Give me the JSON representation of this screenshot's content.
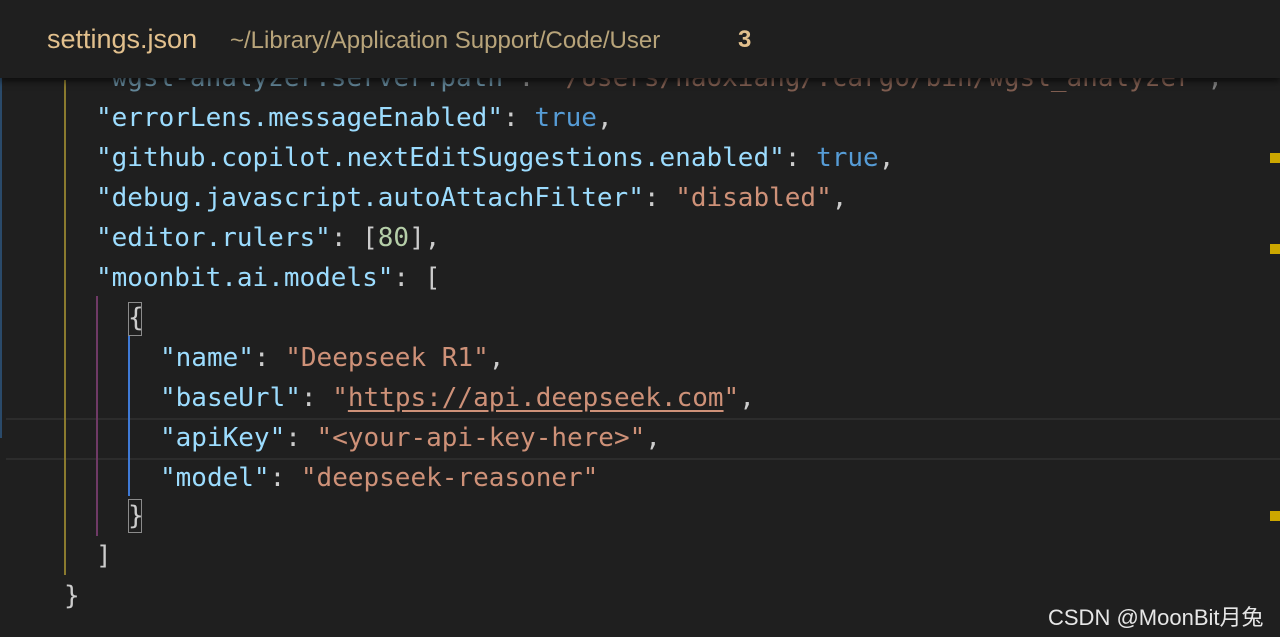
{
  "title_bar": {
    "file_name": "settings.json",
    "path": "~/Library/Application Support/Code/User",
    "problem_count": "3"
  },
  "editor": {
    "lines": [
      {
        "tokens": [
          {
            "text": "\"wgsl-analyzer.server.path\"",
            "cls": "k"
          },
          {
            "text": ": ",
            "cls": "p"
          },
          {
            "text": "\"/Users/haoxiang/.cargo/bin/wgsl_analyzer\"",
            "cls": "s"
          },
          {
            "text": ",",
            "cls": "p"
          }
        ]
      },
      {
        "tokens": [
          {
            "text": "\"errorLens.messageEnabled\"",
            "cls": "k"
          },
          {
            "text": ": ",
            "cls": "p"
          },
          {
            "text": "true",
            "cls": "b"
          },
          {
            "text": ",",
            "cls": "p"
          }
        ]
      },
      {
        "tokens": [
          {
            "text": "\"github.copilot.nextEditSuggestions.enabled\"",
            "cls": "k"
          },
          {
            "text": ": ",
            "cls": "p"
          },
          {
            "text": "true",
            "cls": "b"
          },
          {
            "text": ",",
            "cls": "p"
          }
        ]
      },
      {
        "tokens": [
          {
            "text": "\"debug.javascript.autoAttachFilter\"",
            "cls": "k"
          },
          {
            "text": ": ",
            "cls": "p"
          },
          {
            "text": "\"disabled\"",
            "cls": "s"
          },
          {
            "text": ",",
            "cls": "p"
          }
        ]
      },
      {
        "tokens": [
          {
            "text": "\"editor.rulers\"",
            "cls": "k"
          },
          {
            "text": ": [",
            "cls": "p"
          },
          {
            "text": "80",
            "cls": "n"
          },
          {
            "text": "],",
            "cls": "p"
          }
        ]
      },
      {
        "tokens": [
          {
            "text": "\"moonbit.ai.models\"",
            "cls": "k"
          },
          {
            "text": ": [",
            "cls": "p"
          }
        ]
      },
      {
        "tokens": [
          {
            "text": "{",
            "cls": "p"
          }
        ]
      },
      {
        "tokens": [
          {
            "text": "\"name\"",
            "cls": "k"
          },
          {
            "text": ": ",
            "cls": "p"
          },
          {
            "text": "\"Deepseek R1\"",
            "cls": "s"
          },
          {
            "text": ",",
            "cls": "p"
          }
        ]
      },
      {
        "tokens": [
          {
            "text": "\"baseUrl\"",
            "cls": "k"
          },
          {
            "text": ": ",
            "cls": "p"
          },
          {
            "text": "\"",
            "cls": "s"
          },
          {
            "text": "https://api.deepseek.com",
            "cls": "s u"
          },
          {
            "text": "\"",
            "cls": "s"
          },
          {
            "text": ",",
            "cls": "p"
          }
        ]
      },
      {
        "tokens": [
          {
            "text": "\"apiKey\"",
            "cls": "k"
          },
          {
            "text": ": ",
            "cls": "p"
          },
          {
            "text": "\"<your-api-key-here>\"",
            "cls": "s"
          },
          {
            "text": ",",
            "cls": "p"
          }
        ]
      },
      {
        "tokens": [
          {
            "text": "\"model\"",
            "cls": "k"
          },
          {
            "text": ": ",
            "cls": "p"
          },
          {
            "text": "\"deepseek-reasoner\"",
            "cls": "s"
          }
        ]
      },
      {
        "tokens": [
          {
            "text": "}",
            "cls": "p"
          }
        ]
      },
      {
        "tokens": [
          {
            "text": "]",
            "cls": "p"
          }
        ]
      },
      {
        "tokens": [
          {
            "text": "}",
            "cls": "p"
          }
        ]
      }
    ]
  },
  "watermark": "CSDN @MoonBit月兔"
}
